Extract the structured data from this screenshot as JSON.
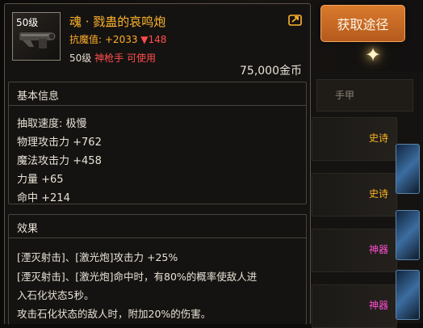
{
  "acquire_button": {
    "label": "获取途径"
  },
  "item": {
    "level_badge": "50级",
    "name": "魂 · 戮蛊的哀鸣炮",
    "anti_magic_label": "抗魔值:",
    "anti_magic_value": "+2033",
    "anti_magic_delta": "▼148",
    "req_level": "50级",
    "req_class": "神枪手",
    "usable": "可使用",
    "price": "75,000金币"
  },
  "basic_info": {
    "title": "基本信息",
    "stats": [
      "抽取速度: 极慢",
      "物理攻击力 +762",
      "魔法攻击力 +458",
      "力量 +65",
      "命中 +214"
    ]
  },
  "effects": {
    "title": "效果",
    "lines": [
      "[湮灭射击]、[激光炮]攻击力 +25%",
      "[湮灭射击]、[激光炮]命中时，有80%的概率使敌人进",
      "入石化状态5秒。",
      "攻击石化状态的敌人时，附加20%的伤害。"
    ]
  },
  "background_list": {
    "header": "手甲",
    "tags": [
      "史诗",
      "史诗",
      "神器",
      "神器"
    ],
    "colors": {
      "epic": "#ffb320",
      "artifact": "#ff4fd0"
    }
  },
  "colors": {
    "name": "#ffb52e",
    "negative": "#ff4d4d",
    "button": "#c96a24"
  }
}
